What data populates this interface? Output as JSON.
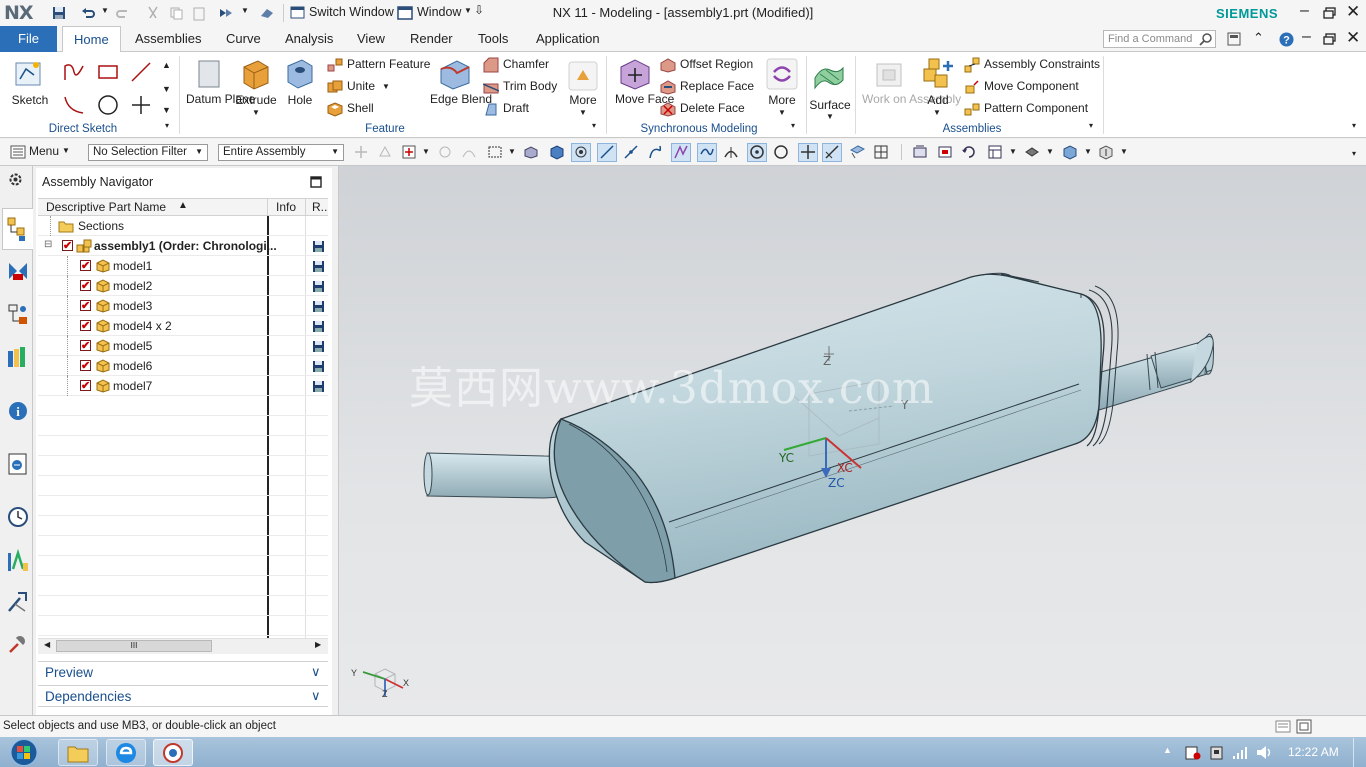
{
  "app": {
    "logo": "NX",
    "title": "NX 11 - Modeling - [assembly1.prt (Modified)]",
    "brand": "SIEMENS",
    "switch_window": "Switch Window",
    "window_menu": "Window"
  },
  "tabs": [
    "File",
    "Home",
    "Assemblies",
    "Curve",
    "Analysis",
    "View",
    "Render",
    "Tools",
    "Application"
  ],
  "find_command_placeholder": "Find a Command",
  "ribbon": {
    "direct_sketch": {
      "sketch": "Sketch",
      "group": "Direct Sketch"
    },
    "feature": {
      "datum_plane": "Datum Plane",
      "extrude": "Extrude",
      "hole": "Hole",
      "pattern_feature": "Pattern Feature",
      "unite": "Unite",
      "shell": "Shell",
      "edge_blend": "Edge Blend",
      "chamfer": "Chamfer",
      "trim_body": "Trim Body",
      "draft": "Draft",
      "more": "More",
      "group": "Feature"
    },
    "sync": {
      "move_face": "Move Face",
      "offset_region": "Offset Region",
      "replace_face": "Replace Face",
      "delete_face": "Delete Face",
      "more": "More",
      "group": "Synchronous Modeling"
    },
    "surface": "Surface",
    "assemblies": {
      "work_on_assembly": "Work on Assembly",
      "add": "Add",
      "assembly_constraints": "Assembly Constraints",
      "move_component": "Move Component",
      "pattern_component": "Pattern Component",
      "group": "Assemblies"
    }
  },
  "toolbar": {
    "menu": "Menu",
    "selection_filter": "No Selection Filter",
    "scope": "Entire Assembly"
  },
  "navigator": {
    "title": "Assembly Navigator",
    "columns": [
      "Descriptive Part Name",
      "Info",
      "R.."
    ],
    "sections": "Sections",
    "root": "assembly1 (Order: Chronologi...",
    "parts": [
      "model1",
      "model2",
      "model3",
      "model4 x 2",
      "model5",
      "model6",
      "model7"
    ],
    "preview": "Preview",
    "dependencies": "Dependencies",
    "scroll_grip": "III"
  },
  "viewport": {
    "watermark": "莫西网www.3dmox.com",
    "csys_labels": {
      "zc": "ZC",
      "yc": "YC",
      "xc": "XC",
      "z": "Z",
      "y": "Y",
      "x": "X"
    }
  },
  "status_text": "Select objects and use MB3, or double-click an object",
  "taskbar": {
    "clock": "12:22 AM"
  },
  "colors": {
    "accent": "#2a6fb8",
    "label_blue": "#1a4f8c",
    "siemens": "#009999",
    "model": "#b8cfd6"
  }
}
